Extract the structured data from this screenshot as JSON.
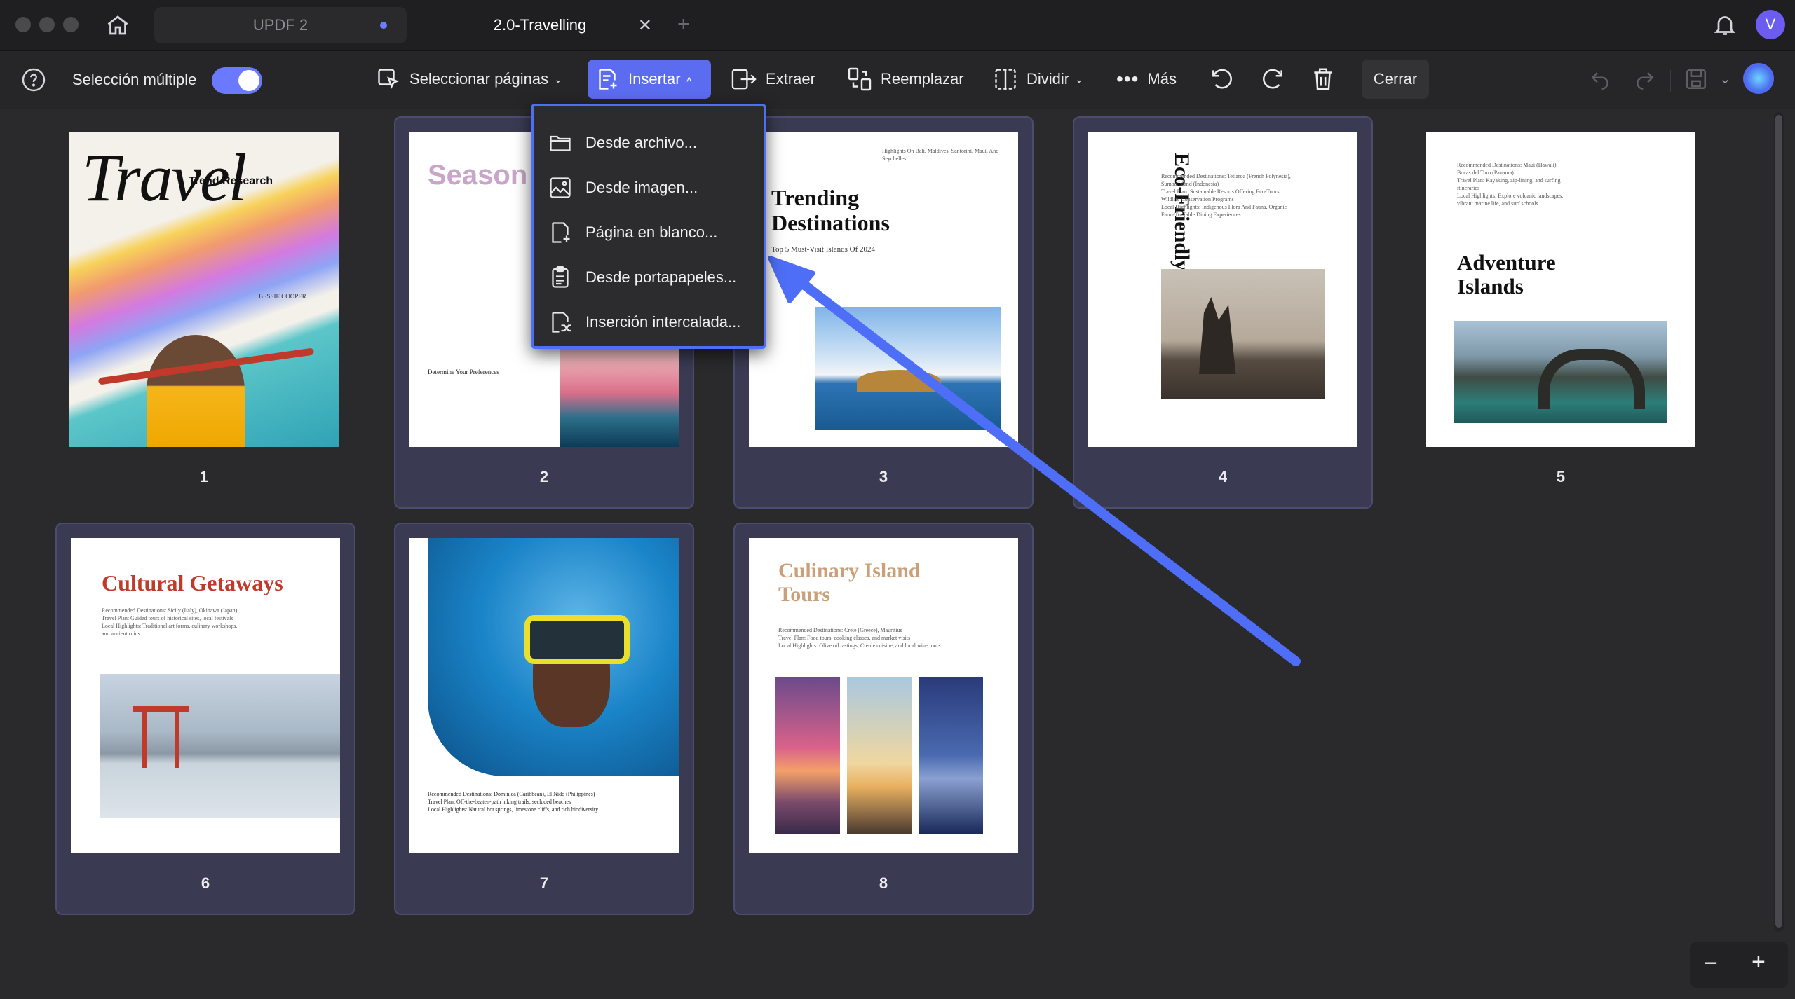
{
  "tabs": {
    "inactive": "UPDF 2",
    "active": "2.0-Travelling"
  },
  "toolbar": {
    "multi_select": "Selección múltiple",
    "select_pages": "Seleccionar páginas",
    "insert": "Insertar",
    "extract": "Extraer",
    "replace": "Reemplazar",
    "split": "Dividir",
    "more": "Más",
    "close": "Cerrar"
  },
  "user": {
    "initial": "V"
  },
  "insert_menu": [
    {
      "label": "Desde archivo...",
      "icon": "folder-icon"
    },
    {
      "label": "Desde imagen...",
      "icon": "image-icon"
    },
    {
      "label": "Página en blanco...",
      "icon": "blank-page-icon"
    },
    {
      "label": "Desde portapapeles...",
      "icon": "clipboard-icon"
    },
    {
      "label": "Inserción intercalada...",
      "icon": "interleave-icon"
    }
  ],
  "pages": [
    {
      "number": "1",
      "title": "Travel",
      "subtitle": "Trend Research",
      "author": "BESSIE COOPER"
    },
    {
      "number": "2",
      "title": "Season",
      "heading": "Determine Your Preferences"
    },
    {
      "number": "3",
      "title": "Trending Destinations",
      "subtitle": "Top 5 Must-Visit Islands Of 2024"
    },
    {
      "number": "4",
      "title": "Eco-Friendly Retreats"
    },
    {
      "number": "5",
      "title": "Adventure Islands"
    },
    {
      "number": "6",
      "title": "Cultural Getaways"
    },
    {
      "number": "7",
      "title": ""
    },
    {
      "number": "8",
      "title": "Culinary Island Tours"
    }
  ],
  "page_text": {
    "p3_top": "Highlights On Bali, Maldives, Santorini, Maui, And Seychelles",
    "p4_text": [
      "Recommended Destinations: Tetiaroa (French Polynesia),",
      "Sumba Island (Indonesia)",
      "Travel Plan: Sustainable Resorts Offering Eco-Tours,",
      "Wildlife Conservation Programs",
      "Local Highlights: Indigenous Flora And Fauna, Organic",
      "Farm-To-Table Dining Experiences"
    ],
    "p5_text": [
      "Recommended Destinations: Maui (Hawaii),",
      "Bocas del Toro (Panama)",
      "Travel Plan: Kayaking, zip-lining, and surfing",
      "itineraries",
      "Local Highlights: Explore volcanic landscapes,",
      "vibrant marine life, and surf schools"
    ],
    "p6_text": [
      "Recommended Destinations: Sicily (Italy), Okinawa (Japan)",
      "Travel Plan: Guided tours of historical sites, local festivals",
      "Local Highlights: Traditional art forms, culinary workshops,",
      "and ancient ruins"
    ],
    "p7_text": [
      "Recommended Destinations: Dominica (Caribbean), El Nido (Philippines)",
      "Travel Plan: Off-the-beaten-path hiking trails, secluded beaches",
      "Local Highlights: Natural hot springs, limestone cliffs, and rich biodiversity"
    ],
    "p8_text": [
      "Recommended Destinations: Crete (Greece), Mauritius",
      "Travel Plan: Food tours, cooking classes, and market visits",
      "Local Highlights: Olive oil tastings, Creole cuisine, and local wine tours"
    ]
  },
  "colors": {
    "accent": "#5b6cf0",
    "arrow": "#4f6ef7",
    "selected_card": "#3a3a52"
  }
}
